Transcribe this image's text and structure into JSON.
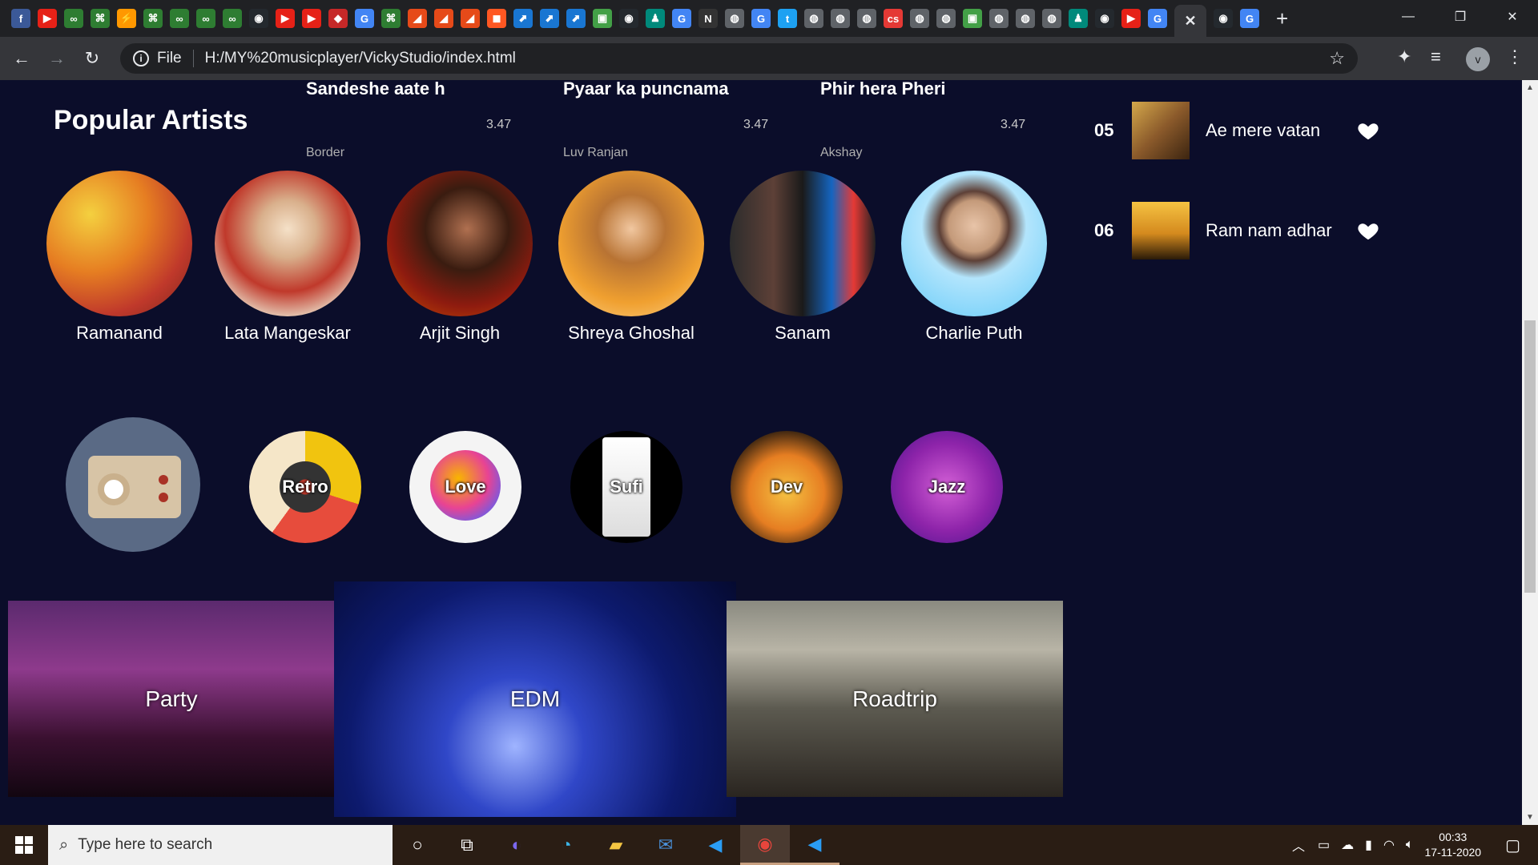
{
  "browser": {
    "tab_favicons": [
      "f",
      "▶",
      "∞",
      "⌘",
      "⚡",
      "⌘",
      "∞",
      "∞",
      "∞",
      "◉",
      "▶",
      "▶",
      "◆",
      "G",
      "⌘",
      "◢",
      "◢",
      "◢",
      "◼",
      "⬈",
      "⬈",
      "⬈",
      "▣",
      "◉",
      "♟",
      "G",
      "N",
      "◍",
      "G",
      "t",
      "◍",
      "◍",
      "◍",
      "cs",
      "◍",
      "◍",
      "▣",
      "◍",
      "◍",
      "◍",
      "♟",
      "◉",
      "▶",
      "G",
      "✕",
      "◉",
      "G"
    ],
    "tab_colors": [
      "#3b5998",
      "#e62117",
      "#2e7d32",
      "#2e7d32",
      "#ff9800",
      "#2e7d32",
      "#2e7d32",
      "#2e7d32",
      "#2e7d32",
      "#24292e",
      "#e62117",
      "#e62117",
      "#c62828",
      "#4285f4",
      "#2e7d32",
      "#e64a19",
      "#e64a19",
      "#e64a19",
      "#ff5722",
      "#1976d2",
      "#1976d2",
      "#1976d2",
      "#43a047",
      "#24292e",
      "#00897b",
      "#4285f4",
      "#333333",
      "#5f6368",
      "#4285f4",
      "#1da1f2",
      "#5f6368",
      "#5f6368",
      "#5f6368",
      "#e53935",
      "#5f6368",
      "#5f6368",
      "#43a047",
      "#5f6368",
      "#5f6368",
      "#5f6368",
      "#00897b",
      "#24292e",
      "#e62117",
      "#4285f4",
      "#35363a",
      "#24292e",
      "#4285f4"
    ],
    "new_tab": "+",
    "window_controls": [
      "—",
      "❐",
      "✕"
    ],
    "nav": {
      "back": "←",
      "forward": "→",
      "reload": "↻"
    },
    "address": {
      "scheme_label": "File",
      "url": "H:/MY%20musicplayer/VickyStudio/index.html"
    },
    "profile_initial": "v"
  },
  "page": {
    "top_songs": [
      {
        "title": "Sandeshe aate h",
        "duration": "3.47",
        "artist": "Border"
      },
      {
        "title": "Pyaar ka puncnama",
        "duration": "3.47",
        "artist": "Luv Ranjan"
      },
      {
        "title": "Phir hera Pheri",
        "duration": "3.47",
        "artist": "Akshay"
      }
    ],
    "popular_heading": "Popular Artists",
    "artists": [
      {
        "name": "Ramanand"
      },
      {
        "name": "Lata Mangeskar"
      },
      {
        "name": "Arjit Singh"
      },
      {
        "name": "Shreya Ghoshal"
      },
      {
        "name": "Sanam"
      },
      {
        "name": "Charlie Puth"
      }
    ],
    "genres": [
      {
        "label": ""
      },
      {
        "label": "Retro"
      },
      {
        "label": "Love"
      },
      {
        "label": "Sufi"
      },
      {
        "label": "Dev"
      },
      {
        "label": "Jazz"
      }
    ],
    "moods": [
      {
        "label": "Party"
      },
      {
        "label": "EDM"
      },
      {
        "label": "Roadtrip"
      }
    ],
    "queue": [
      {
        "num": "05",
        "title": "Ae mere vatan"
      },
      {
        "num": "06",
        "title": "Ram nam adhar"
      }
    ]
  },
  "taskbar": {
    "search_placeholder": "Type here to search",
    "time": "00:33",
    "date": "17-11-2020"
  }
}
